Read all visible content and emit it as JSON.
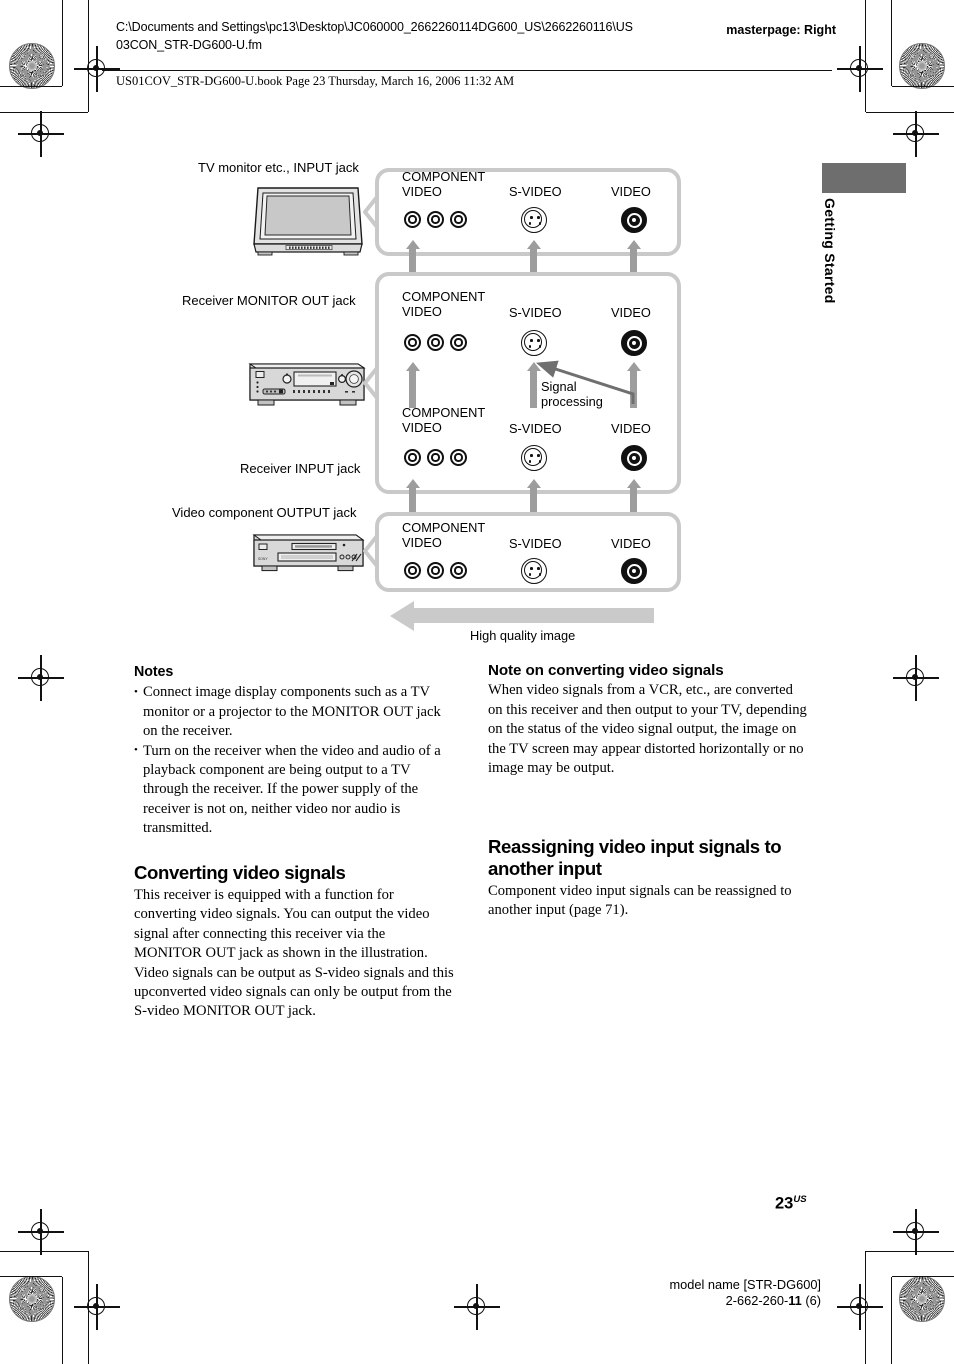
{
  "header": {
    "file_path": "C:\\Documents and Settings\\pc13\\Desktop\\JC060000_2662260114DG600_US\\2662260116\\US03CON_STR-DG600-U.fm",
    "masterpage": "masterpage: Right",
    "book_line": "US01COV_STR-DG600-U.book  Page 23  Thursday, March 16, 2006  11:32 AM"
  },
  "side_tab": {
    "label": "Getting Started"
  },
  "diagram": {
    "row_labels": {
      "tv": "TV monitor etc., INPUT jack",
      "monitor_out": "Receiver MONITOR OUT jack",
      "receiver_input": "Receiver INPUT jack",
      "video_component": "Video component OUTPUT jack"
    },
    "jack_groups": [
      {
        "component": "COMPONENT",
        "component2": "VIDEO",
        "svideo": "S-VIDEO",
        "video": "VIDEO"
      },
      {
        "component": "COMPONENT",
        "component2": "VIDEO",
        "svideo": "S-VIDEO",
        "video": "VIDEO"
      },
      {
        "component": "COMPONENT",
        "component2": "VIDEO",
        "svideo": "S-VIDEO",
        "video": "VIDEO"
      },
      {
        "component": "COMPONENT",
        "component2": "VIDEO",
        "svideo": "S-VIDEO",
        "video": "VIDEO"
      }
    ],
    "signal_processing_line1": "Signal",
    "signal_processing_line2": "processing",
    "high_quality_caption": "High quality image",
    "colors": {
      "box_border": "#c9c9c9",
      "arrow": "#9d9d9d",
      "big_arrow": "#cacaca",
      "tab_block": "#6e6e6e"
    }
  },
  "left_column": {
    "notes_heading": "Notes",
    "notes": [
      "Connect image display components such as a TV monitor or a projector to the MONITOR OUT jack on the receiver.",
      "Turn on the receiver when the video and audio of a playback component are being output to a TV through the receiver. If the power supply of the receiver is not on, neither video nor audio is transmitted."
    ],
    "section_heading": "Converting video signals",
    "paragraph1": "This receiver is equipped with a function for converting video signals. You can output the video signal after connecting this receiver via the MONITOR OUT jack as shown in the illustration.",
    "paragraph2": "Video signals can be output as S-video signals and this upconverted video signals can only be output from the S-video MONITOR OUT jack."
  },
  "right_column": {
    "note_heading": "Note on converting video signals",
    "note_body": "When video signals from a VCR, etc., are converted on this receiver and then output to your TV, depending on the status of the video signal output, the image on the TV screen may appear distorted horizontally or no image may be output.",
    "section_heading": "Reassigning video input signals to another input",
    "paragraph1": "Component video input signals can be reassigned to another input (page 71)."
  },
  "footer": {
    "page_number": "23",
    "page_suffix": "US",
    "model_name": "model name [STR-DG600]",
    "doc_code_prefix": "2-662-260-",
    "doc_code_bold": "11",
    "doc_code_suffix": " (6)"
  }
}
